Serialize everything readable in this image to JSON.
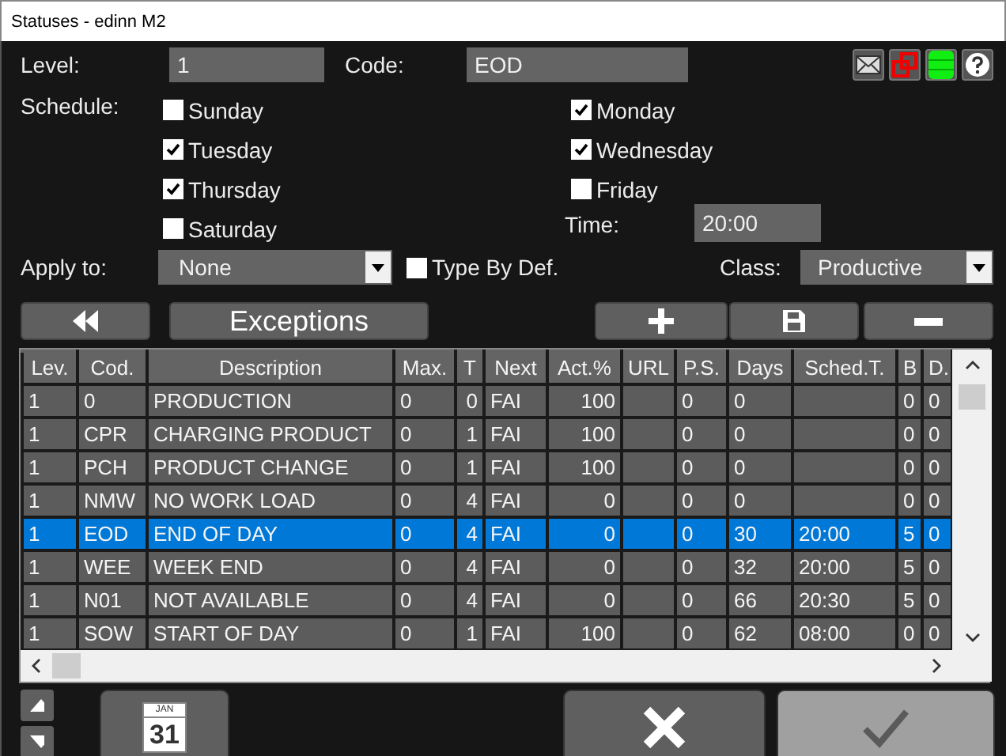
{
  "window": {
    "title": "Statuses - edinn M2"
  },
  "level": {
    "label": "Level:",
    "value": "1"
  },
  "code": {
    "label": "Code:",
    "value": "EOD"
  },
  "schedule": {
    "label": "Schedule:",
    "days": [
      {
        "label": "Sunday",
        "checked": false
      },
      {
        "label": "Monday",
        "checked": true
      },
      {
        "label": "Tuesday",
        "checked": true
      },
      {
        "label": "Wednesday",
        "checked": true
      },
      {
        "label": "Thursday",
        "checked": true
      },
      {
        "label": "Friday",
        "checked": false
      },
      {
        "label": "Saturday",
        "checked": false
      }
    ]
  },
  "time": {
    "label": "Time:",
    "value": "20:00"
  },
  "apply_to": {
    "label": "Apply to:",
    "value": "None"
  },
  "type_by_def": {
    "label": "Type By Def.",
    "checked": false
  },
  "class": {
    "label": "Class:",
    "value": "Productive"
  },
  "exceptions_button": "Exceptions",
  "table": {
    "columns": [
      "Lev.",
      "Cod.",
      "Description",
      "Max.",
      "T",
      "Next",
      "Act.%",
      "URL",
      "P.S.",
      "Days",
      "Sched.T.",
      "B",
      "D."
    ],
    "rows": [
      {
        "cells": [
          "1",
          "0",
          "PRODUCTION",
          "0",
          "0",
          "FAI",
          "100",
          null,
          "0",
          "0",
          null,
          "0",
          "0"
        ],
        "selected": false
      },
      {
        "cells": [
          "1",
          "CPR",
          "CHARGING PRODUCT",
          "0",
          "1",
          "FAI",
          "100",
          null,
          "0",
          "0",
          null,
          "0",
          "0"
        ],
        "selected": false
      },
      {
        "cells": [
          "1",
          "PCH",
          "PRODUCT CHANGE",
          "0",
          "1",
          "FAI",
          "100",
          null,
          "0",
          "0",
          null,
          "0",
          "0"
        ],
        "selected": false
      },
      {
        "cells": [
          "1",
          "NMW",
          "NO WORK LOAD",
          "0",
          "4",
          "FAI",
          "0",
          null,
          "0",
          "0",
          null,
          "0",
          "0"
        ],
        "selected": false
      },
      {
        "cells": [
          "1",
          "EOD",
          "END OF DAY",
          "0",
          "4",
          "FAI",
          "0",
          null,
          "0",
          "30",
          "20:00",
          "5",
          "0"
        ],
        "selected": true
      },
      {
        "cells": [
          "1",
          "WEE",
          "WEEK END",
          "0",
          "4",
          "FAI",
          "0",
          null,
          "0",
          "32",
          "20:00",
          "5",
          "0"
        ],
        "selected": false
      },
      {
        "cells": [
          "1",
          "N01",
          "NOT AVAILABLE",
          "0",
          "4",
          "FAI",
          "0",
          null,
          "0",
          "66",
          "20:30",
          "5",
          "0"
        ],
        "selected": false
      },
      {
        "cells": [
          "1",
          "SOW",
          "START OF DAY",
          "0",
          "1",
          "FAI",
          "100",
          null,
          "0",
          "62",
          "08:00",
          "0",
          "0"
        ],
        "selected": false
      }
    ]
  },
  "calendar": {
    "month": "JAN",
    "day": "31"
  },
  "confirm_button": {
    "disabled": true
  }
}
